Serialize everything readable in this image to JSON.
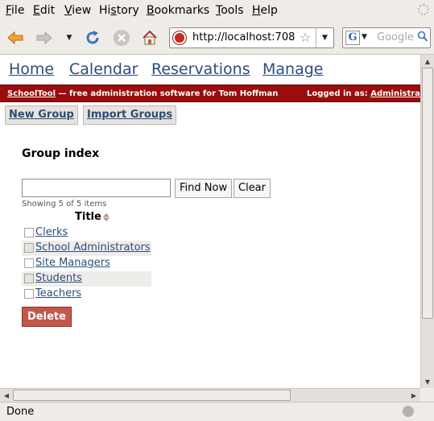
{
  "menu": [
    "File",
    "Edit",
    "View",
    "History",
    "Bookmarks",
    "Tools",
    "Help"
  ],
  "menu_mnemonics": [
    "F",
    "E",
    "V",
    "s",
    "B",
    "T",
    "H"
  ],
  "url": "http://localhost:708",
  "search": {
    "placeholder": "Google",
    "engine_letter": "G"
  },
  "site_nav": [
    "Home",
    "Calendar",
    "Reservations",
    "Manage"
  ],
  "banner": {
    "brand": "SchoolTool",
    "tagline": " — free administration software for Tom Hoffman",
    "logged_in_label": "Logged in as: ",
    "logged_in_user": "Administrator"
  },
  "actions": {
    "new_group": "New Group",
    "import_groups": "Import Groups"
  },
  "page": {
    "heading": "Group index",
    "find_now": "Find Now",
    "clear": "Clear",
    "count_text": "Showing 5 of 5 items",
    "column_title": "Title",
    "delete": "Delete"
  },
  "groups": [
    "Clerks",
    "School Administrators",
    "Site Managers",
    "Students",
    "Teachers"
  ],
  "status": "Done",
  "colors": {
    "banner_bg": "#9b0c0c",
    "link": "#2c4d7a",
    "delete_bg": "#c1584b",
    "chrome_bg": "#efebe7"
  }
}
